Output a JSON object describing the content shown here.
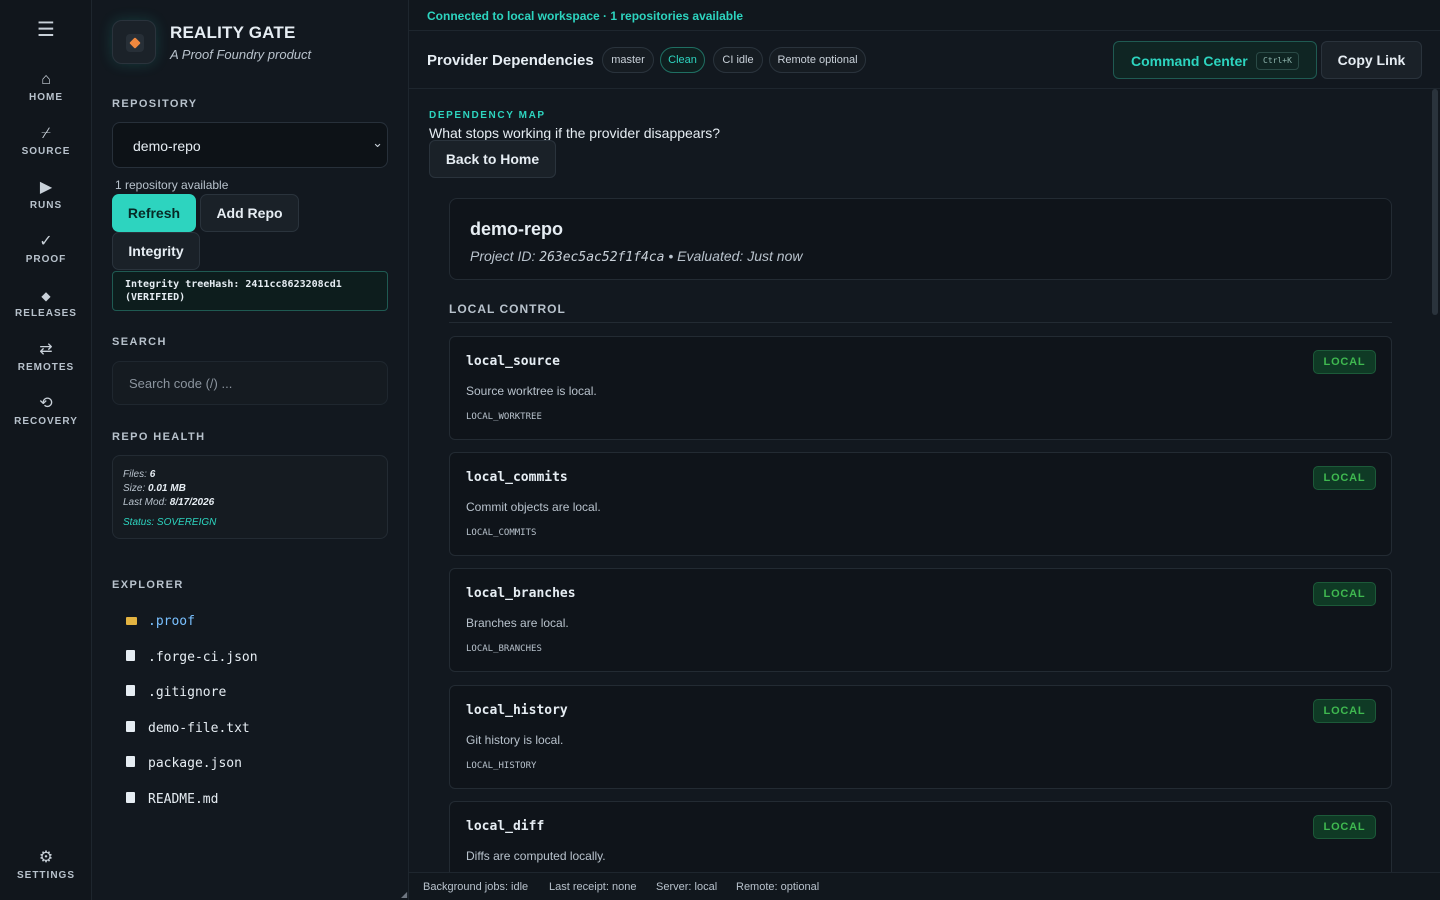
{
  "rail": {
    "menu_icon": "menu-icon",
    "items": [
      {
        "label": "HOME",
        "icon": "home-icon",
        "glyph": "⌂"
      },
      {
        "label": "SOURCE",
        "icon": "source-icon",
        "glyph": "⌿"
      },
      {
        "label": "RUNS",
        "icon": "play-icon",
        "glyph": "▶"
      },
      {
        "label": "PROOF",
        "icon": "check-icon",
        "glyph": "✓"
      },
      {
        "label": "RELEASES",
        "icon": "diamond-icon",
        "glyph": "◆"
      },
      {
        "label": "REMOTES",
        "icon": "swap-arrows-icon",
        "glyph": "⇄"
      },
      {
        "label": "RECOVERY",
        "icon": "restore-icon",
        "glyph": "⟲"
      }
    ],
    "settings": {
      "label": "SETTINGS",
      "icon": "gear-icon",
      "glyph": "⚙"
    }
  },
  "brand": {
    "name": "REALITY GATE",
    "tagline": "A Proof Foundry product"
  },
  "repository": {
    "label": "REPOSITORY",
    "selected": "demo-repo",
    "count_text": "1 repository available",
    "refresh_label": "Refresh",
    "add_label": "Add Repo",
    "integrity_label": "Integrity",
    "integrity_line1": "Integrity treeHash: 2411cc8623208cd1",
    "integrity_line2": "(VERIFIED)"
  },
  "search": {
    "label": "SEARCH",
    "placeholder": "Search code (/) ..."
  },
  "repo_health": {
    "label": "REPO HEALTH",
    "files_label": "Files:",
    "files": "6",
    "size_label": "Size:",
    "size": "0.01 MB",
    "lastmod_label": "Last Mod:",
    "lastmod": "8/17/2026",
    "status_text": "Status: SOVEREIGN"
  },
  "explorer": {
    "label": "EXPLORER",
    "items": [
      {
        "name": ".proof",
        "type": "folder"
      },
      {
        "name": ".forge-ci.json",
        "type": "file"
      },
      {
        "name": ".gitignore",
        "type": "file"
      },
      {
        "name": "demo-file.txt",
        "type": "file"
      },
      {
        "name": "package.json",
        "type": "file"
      },
      {
        "name": "README.md",
        "type": "file"
      }
    ]
  },
  "connection": "Connected to local workspace · 1 repositories available",
  "header": {
    "title": "Provider Dependencies",
    "pills": [
      "master",
      "Clean",
      "CI idle",
      "Remote optional"
    ],
    "command_center": "Command Center",
    "shortcut": "Ctrl+K",
    "copy_link": "Copy Link"
  },
  "dependency_map": {
    "eyebrow": "DEPENDENCY MAP",
    "question": "What stops working if the provider disappears?",
    "back_label": "Back to Home"
  },
  "project": {
    "name": "demo-repo",
    "id_label": "Project ID:",
    "id": "263ec5ac52f1f4ca",
    "evaluated": "• Evaluated: Just now"
  },
  "local_control": {
    "label": "LOCAL CONTROL",
    "items": [
      {
        "name": "local_source",
        "desc": "Source worktree is local.",
        "code": "LOCAL_WORKTREE",
        "badge": "LOCAL"
      },
      {
        "name": "local_commits",
        "desc": "Commit objects are local.",
        "code": "LOCAL_COMMITS",
        "badge": "LOCAL"
      },
      {
        "name": "local_branches",
        "desc": "Branches are local.",
        "code": "LOCAL_BRANCHES",
        "badge": "LOCAL"
      },
      {
        "name": "local_history",
        "desc": "Git history is local.",
        "code": "LOCAL_HISTORY",
        "badge": "LOCAL"
      },
      {
        "name": "local_diff",
        "desc": "Diffs are computed locally.",
        "code": "",
        "badge": "LOCAL"
      }
    ]
  },
  "status_bar": [
    "Background jobs: idle",
    "Last receipt: none",
    "Server: local",
    "Remote: optional"
  ],
  "colors": {
    "accent": "#2dd4bf",
    "background": "#0f1419",
    "badge_local": "#3fb950",
    "folder": "#e3b341"
  }
}
